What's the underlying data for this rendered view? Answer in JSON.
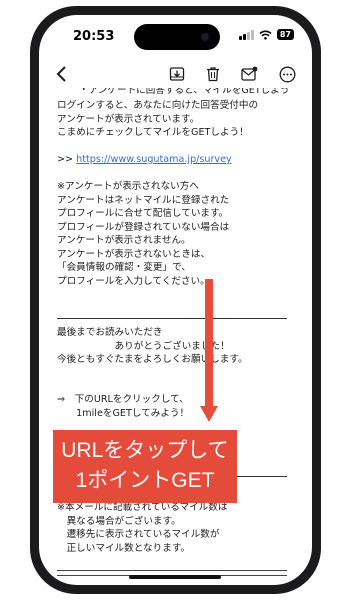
{
  "status_bar": {
    "time": "20:53",
    "battery": "87"
  },
  "toolbar": {
    "icons": [
      "back-chevron-icon",
      "archive-icon",
      "trash-icon",
      "compose-icon",
      "more-icon"
    ]
  },
  "email": {
    "cut_top_line": "・アンケートに回答すると、マイルをGETしよう",
    "intro": [
      "ログインすると、あなたに向けた回答受付中の",
      "アンケートが表示されています。",
      "こまめにチェックしてマイルをGETしよう！"
    ],
    "link_prefix": ">> ",
    "link_text": "https://www.sugutama.jp/survey",
    "note": [
      "※アンケートが表示されない方へ",
      "アンケートはネットマイルに登録された",
      "プロフィールに合せて配信しています。",
      "プロフィールが登録されていない場合は",
      "アンケートが表示されません。",
      "アンケートが表示されないときは、",
      "「会員情報の確認・変更」で、",
      "プロフィールを入力してください。"
    ],
    "thanks": [
      "最後までお読みいただき",
      "　　　　　　ありがとうございました！",
      "今後ともすぐたまをよろしくお願いします。"
    ],
    "cta": [
      "⇒　下のURLをクリックして、",
      "　　1mileをGETしてみよう！"
    ],
    "footer_note": [
      "※本メールに記載されているマイル数は",
      "　異なる場合がございます。",
      "　遷移先に表示されているマイル数が",
      "　正しいマイル数となります。"
    ]
  },
  "annotation": {
    "line1": "URLをタップして",
    "line2": "1ポイントGET",
    "color": "#e44b3a"
  }
}
